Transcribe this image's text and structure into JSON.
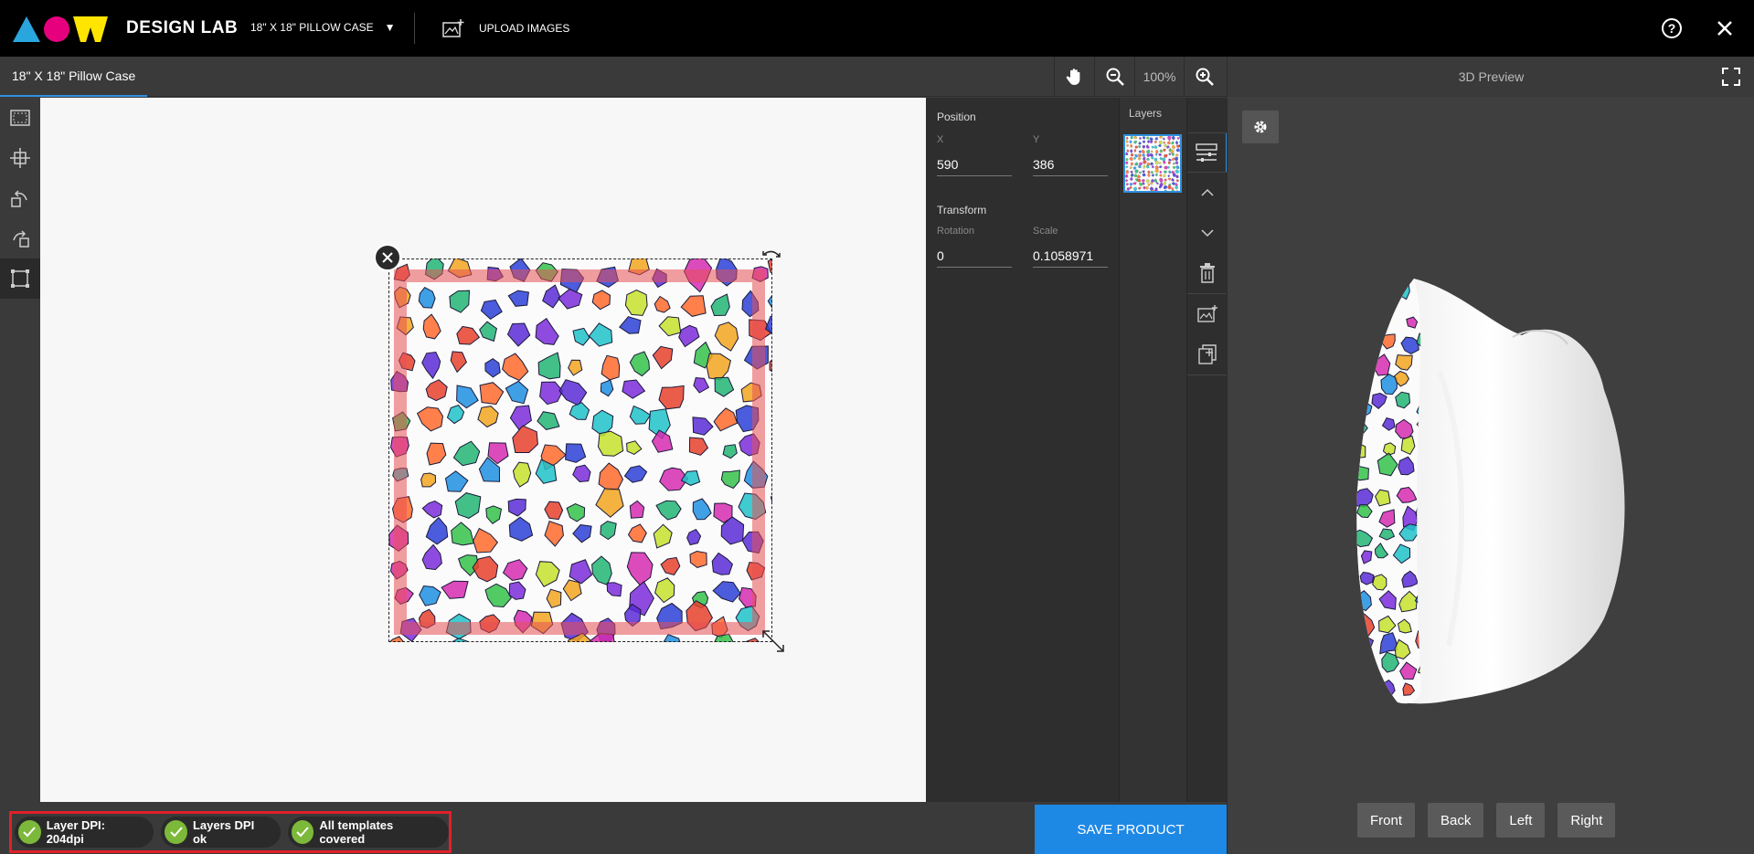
{
  "app": {
    "title": "DESIGN LAB",
    "product_selector": "18\" X 18\" PILLOW CASE",
    "upload_label": "UPLOAD IMAGES",
    "colors": {
      "brand_blue": "#2aa6df",
      "brand_magenta": "#e6007e",
      "brand_yellow": "#ffe500",
      "accent": "#1e88e5"
    }
  },
  "tabs": {
    "document_tab": "18\" X 18\" Pillow Case"
  },
  "zoom": {
    "level": "100%"
  },
  "preview": {
    "title": "3D Preview",
    "views": [
      "Front",
      "Back",
      "Left",
      "Right"
    ]
  },
  "properties": {
    "position_title": "Position",
    "x_label": "X",
    "x_value": "590",
    "y_label": "Y",
    "y_value": "386",
    "transform_title": "Transform",
    "rotation_label": "Rotation",
    "rotation_value": "0",
    "scale_label": "Scale",
    "scale_value": "0.1058971"
  },
  "layers": {
    "title": "Layers"
  },
  "status": {
    "items": [
      "Layer DPI: 204dpi",
      "Layers DPI ok",
      "All templates covered"
    ],
    "status_color": "#7cb83a"
  },
  "actions": {
    "save_label": "SAVE PRODUCT"
  }
}
